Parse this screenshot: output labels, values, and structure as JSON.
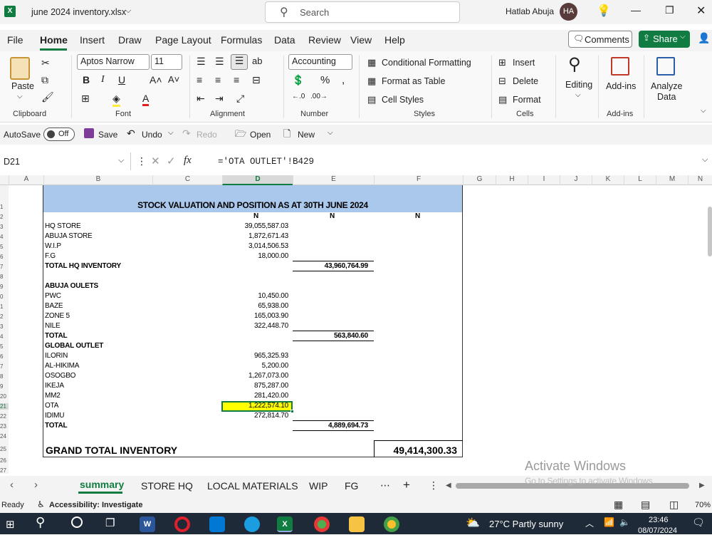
{
  "window": {
    "filename": "june 2024 inventory.xlsx",
    "search_placeholder": "Search",
    "user_name": "Hatlab Abuja",
    "avatar_initials": "HA"
  },
  "menu": {
    "items": [
      "File",
      "Home",
      "Insert",
      "Draw",
      "Page Layout",
      "Formulas",
      "Data",
      "Review",
      "View",
      "Help"
    ],
    "comments": "Comments",
    "share": "Share"
  },
  "ribbon": {
    "paste": "Paste",
    "font_name": "Aptos Narrow",
    "font_size": "11",
    "number_format": "Accounting",
    "conditional_formatting": "Conditional Formatting",
    "format_as_table": "Format as Table",
    "cell_styles": "Cell Styles",
    "insert": "Insert",
    "delete": "Delete",
    "format": "Format",
    "editing": "Editing",
    "add_ins": "Add-ins",
    "analyze_1": "Analyze",
    "analyze_2": "Data",
    "groups": {
      "clipboard": "Clipboard",
      "font": "Font",
      "alignment": "Alignment",
      "number": "Number",
      "styles": "Styles",
      "cells": "Cells",
      "addins": "Add-ins"
    }
  },
  "qat": {
    "autosave": "AutoSave",
    "toggle": "Off",
    "save": "Save",
    "undo": "Undo",
    "redo": "Redo",
    "open": "Open",
    "new": "New"
  },
  "formula_bar": {
    "name_box": "D21",
    "formula": "='OTA OUTLET'!B429"
  },
  "columns": [
    "A",
    "B",
    "C",
    "D",
    "E",
    "F",
    "G",
    "H",
    "I",
    "J",
    "K",
    "L",
    "M",
    "N"
  ],
  "sheet": {
    "title": "STOCK VALUATION AND POSITION AS AT 30TH JUNE 2024",
    "currency": "N",
    "rows": [
      {
        "r": "3",
        "label": "HQ STORE",
        "d": "39,055,587.03"
      },
      {
        "r": "4",
        "label": "ABUJA STORE",
        "d": "1,872,671.43"
      },
      {
        "r": "5",
        "label": "W.I.P",
        "d": "3,014,506.53"
      },
      {
        "r": "6",
        "label": "F.G",
        "d": "18,000.00"
      },
      {
        "r": "7",
        "label": "TOTAL HQ INVENTORY",
        "e": "43,960,764.99",
        "bold": true
      },
      {
        "r": "9",
        "label": "ABUJA OULETS",
        "bold": true
      },
      {
        "r": "10",
        "label": "PWC",
        "d": "10,450.00"
      },
      {
        "r": "11",
        "label": "BAZE",
        "d": "65,938.00"
      },
      {
        "r": "12",
        "label": "ZONE 5",
        "d": "165,003.90"
      },
      {
        "r": "13",
        "label": "NILE",
        "d": "322,448.70"
      },
      {
        "r": "14",
        "label": "TOTAL",
        "e": "563,840.60",
        "bold": true
      },
      {
        "r": "15",
        "label": "GLOBAL OUTLET",
        "bold": true
      },
      {
        "r": "16",
        "label": "ILORIN",
        "d": "965,325.93"
      },
      {
        "r": "17",
        "label": "AL-HIKIMA",
        "d": "5,200.00"
      },
      {
        "r": "18",
        "label": "OSOGBO",
        "d": "1,267,073.00"
      },
      {
        "r": "19",
        "label": "IKEJA",
        "d": "875,287.00"
      },
      {
        "r": "20",
        "label": "MM2",
        "d": "281,420.00"
      },
      {
        "r": "21",
        "label": "OTA",
        "d": "1,222,574.10"
      },
      {
        "r": "22",
        "label": "IDIMU",
        "d": "272,814.70"
      },
      {
        "r": "23",
        "label": "TOTAL",
        "e": "4,889,694.73",
        "bold": true
      }
    ],
    "grand_total_label": "GRAND TOTAL INVENTORY",
    "grand_total_value": "49,414,300.33"
  },
  "sheet_tabs": [
    "summary",
    "STORE HQ",
    "LOCAL MATERIALS",
    "WIP",
    "FG"
  ],
  "status": {
    "ready": "Ready",
    "accessibility": "Accessibility: Investigate",
    "zoom": "70%",
    "watermark_1": "Activate Windows",
    "watermark_2": "Go to Settings to activate Windows."
  },
  "taskbar": {
    "weather": "27°C  Partly sunny",
    "time": "23:46",
    "date": "08/07/2024"
  }
}
